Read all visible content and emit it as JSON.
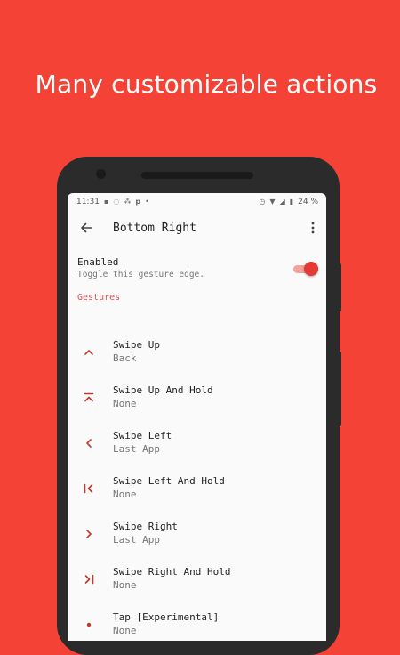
{
  "promo": {
    "headline": "Many customizable actions"
  },
  "status_bar": {
    "time": "11:31",
    "battery": "24 %"
  },
  "app_bar": {
    "title": "Bottom Right"
  },
  "enabled_setting": {
    "title": "Enabled",
    "summary": "Toggle this gesture edge.",
    "checked": true
  },
  "section": {
    "title": "Gestures"
  },
  "gestures": [
    {
      "title": "Swipe Up",
      "value": "Back",
      "icon": "chevron-up-icon"
    },
    {
      "title": "Swipe Up And Hold",
      "value": "None",
      "icon": "chevron-up-bar-icon"
    },
    {
      "title": "Swipe Left",
      "value": "Last App",
      "icon": "chevron-left-icon"
    },
    {
      "title": "Swipe Left And Hold",
      "value": "None",
      "icon": "chevron-left-bar-icon"
    },
    {
      "title": "Swipe Right",
      "value": "Last App",
      "icon": "chevron-right-icon"
    },
    {
      "title": "Swipe Right And Hold",
      "value": "None",
      "icon": "chevron-right-bar-icon"
    },
    {
      "title": "Tap [Experimental]",
      "value": "None",
      "icon": "dot-icon"
    }
  ],
  "colors": {
    "background": "#f44336",
    "accent": "#e53935",
    "icon": "#c0392b",
    "section_header": "#d9534f"
  }
}
